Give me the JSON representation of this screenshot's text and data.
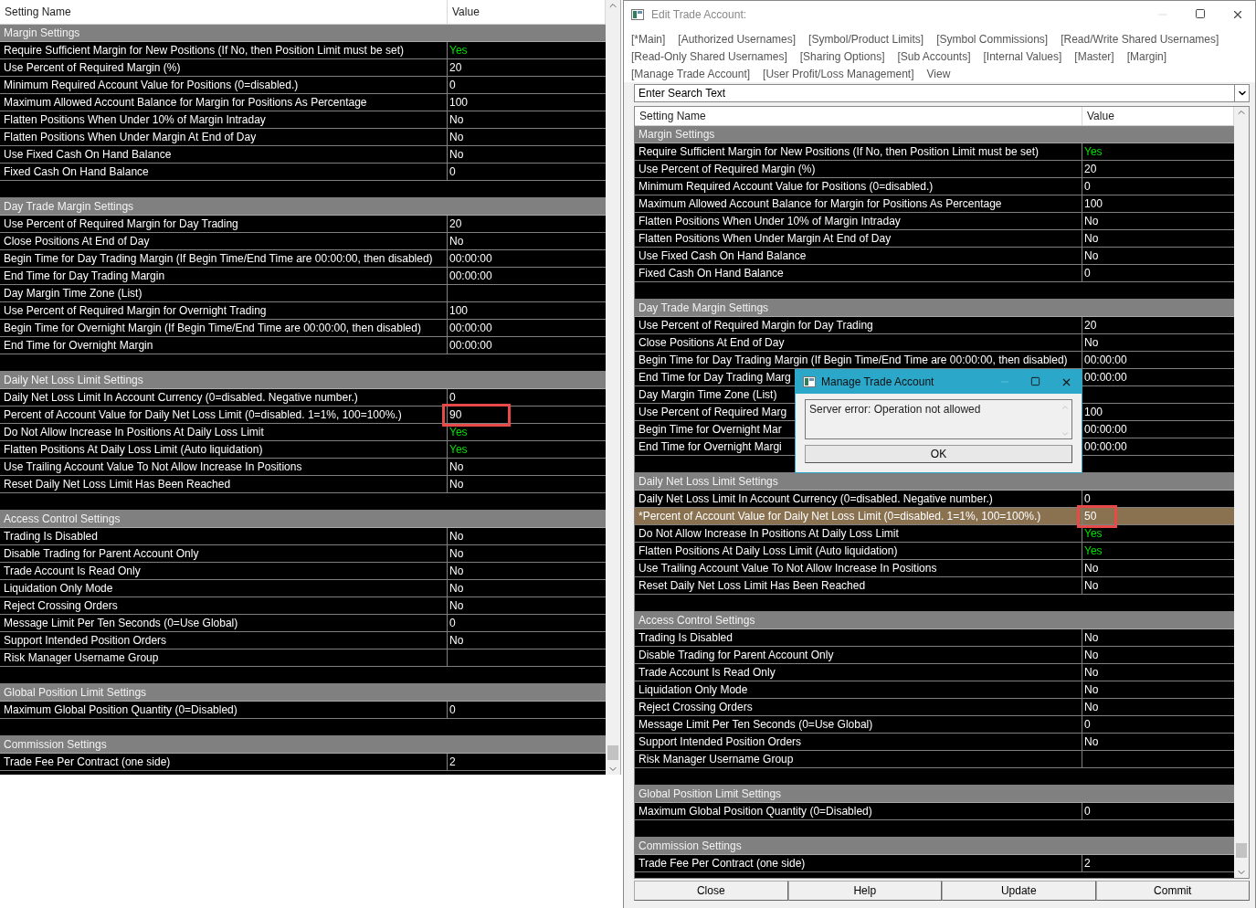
{
  "left_panel": {
    "columns": [
      "Setting Name",
      "Value"
    ],
    "sections": [
      {
        "title": "Margin Settings",
        "rows": [
          {
            "name": "Require Sufficient Margin for New Positions (If No, then Position Limit must be set)",
            "value": "Yes",
            "accent": true,
            "boxed": false
          },
          {
            "name": "Use Percent of Required Margin (%)",
            "value": "20",
            "accent": false,
            "boxed": false
          },
          {
            "name": "Minimum Required Account Value for Positions (0=disabled.)",
            "value": "0",
            "accent": false,
            "boxed": false
          },
          {
            "name": "Maximum Allowed Account Balance for Margin for Positions As Percentage",
            "value": "100",
            "accent": false,
            "boxed": false
          },
          {
            "name": "Flatten Positions When Under 10% of Margin Intraday",
            "value": "No",
            "accent": false,
            "boxed": false
          },
          {
            "name": "Flatten Positions When Under Margin At End of Day",
            "value": "No",
            "accent": false,
            "boxed": false
          },
          {
            "name": "Use Fixed Cash On Hand Balance",
            "value": "No",
            "accent": false,
            "boxed": false
          },
          {
            "name": "Fixed Cash On Hand Balance",
            "value": "0",
            "accent": false,
            "boxed": false
          }
        ]
      },
      {
        "title": "Day Trade Margin Settings",
        "rows": [
          {
            "name": "Use Percent of Required Margin for Day Trading",
            "value": "20",
            "accent": false,
            "boxed": false
          },
          {
            "name": "Close Positions At End of Day",
            "value": "No",
            "accent": false,
            "boxed": false
          },
          {
            "name": "Begin Time for Day Trading Margin (If Begin Time/End Time are 00:00:00, then disabled)",
            "value": "00:00:00",
            "accent": false,
            "boxed": false
          },
          {
            "name": "End Time for Day Trading Margin",
            "value": "00:00:00",
            "accent": false,
            "boxed": false
          },
          {
            "name": "Day Margin Time Zone (List)",
            "boxed": false
          },
          {
            "name": "Use Percent of Required Margin for Overnight Trading",
            "value": "100",
            "accent": false,
            "boxed": false
          },
          {
            "name": "Begin Time for Overnight Margin (If Begin Time/End Time are 00:00:00, then disabled)",
            "value": "00:00:00",
            "accent": false,
            "boxed": false
          },
          {
            "name": "End Time for Overnight Margin",
            "value": "00:00:00",
            "accent": false,
            "boxed": false
          }
        ]
      },
      {
        "title": "Daily Net Loss Limit Settings",
        "rows": [
          {
            "name": "Daily Net Loss Limit In Account Currency (0=disabled. Negative number.)",
            "value": "0",
            "accent": false,
            "boxed": false
          },
          {
            "name": "Percent of Account Value for Daily Net Loss Limit (0=disabled. 1=1%, 100=100%.)",
            "value": "90",
            "accent": false,
            "boxed": true
          },
          {
            "name": "Do Not Allow Increase In Positions At Daily Loss Limit",
            "value": "Yes",
            "accent": true,
            "boxed": false
          },
          {
            "name": "Flatten Positions At Daily Loss Limit (Auto liquidation)",
            "value": "Yes",
            "accent": true,
            "boxed": false
          },
          {
            "name": "Use Trailing Account Value To Not Allow Increase In Positions",
            "value": "No",
            "accent": false,
            "boxed": false
          },
          {
            "name": "Reset Daily Net Loss Limit Has Been Reached",
            "value": "No",
            "accent": false,
            "boxed": false
          }
        ]
      },
      {
        "title": "Access Control Settings",
        "rows": [
          {
            "name": "Trading Is Disabled",
            "value": "No",
            "accent": false,
            "boxed": false
          },
          {
            "name": "Disable Trading for Parent Account Only",
            "value": "No",
            "accent": false,
            "boxed": false
          },
          {
            "name": "Trade Account Is Read Only",
            "value": "No",
            "accent": false,
            "boxed": false
          },
          {
            "name": "Liquidation Only Mode",
            "value": "No",
            "accent": false,
            "boxed": false
          },
          {
            "name": "Reject Crossing Orders",
            "value": "No",
            "accent": false,
            "boxed": false
          },
          {
            "name": "Message Limit Per Ten Seconds (0=Use Global)",
            "value": "0",
            "accent": false,
            "boxed": false
          },
          {
            "name": "Support Intended Position Orders",
            "value": "No",
            "accent": false,
            "boxed": false
          },
          {
            "name": "Risk Manager Username Group",
            "boxed": false
          }
        ]
      },
      {
        "title": "Global Position Limit Settings",
        "rows": [
          {
            "name": "Maximum Global Position Quantity (0=Disabled)",
            "value": "0",
            "accent": false,
            "boxed": false
          }
        ]
      },
      {
        "title": "Commission Settings",
        "rows": [
          {
            "name": "Trade Fee Per Contract (one side)",
            "value": "2",
            "accent": false,
            "boxed": false
          }
        ]
      }
    ]
  },
  "edit_window": {
    "title": "Edit Trade Account:",
    "tab_rows": [
      [
        "[*Main]",
        "[Authorized Usernames]",
        "[Symbol/Product Limits]",
        "[Symbol Commissions]",
        "[Read/Write Shared Usernames]"
      ],
      [
        "[Read-Only Shared Usernames]",
        "[Sharing Options]",
        "[Sub Accounts]",
        "[Internal Values]",
        "[Master]",
        "[Margin]"
      ],
      [
        "[Manage Trade Account]",
        "[User Profit/Loss Management]",
        "View"
      ]
    ],
    "search": {
      "value": "Enter Search Text"
    },
    "table": {
      "columns": [
        "Setting Name",
        "Value"
      ],
      "sections": [
        {
          "title": "Margin Settings",
          "rows": [
            {
              "name": "Require Sufficient Margin for New Positions (If No, then Position Limit must be set)",
              "value": "Yes",
              "accent": true,
              "boxed": false,
              "selected": false
            },
            {
              "name": "Use Percent of Required Margin (%)",
              "value": "20",
              "accent": false,
              "boxed": false,
              "selected": false
            },
            {
              "name": "Minimum Required Account Value for Positions (0=disabled.)",
              "value": "0",
              "accent": false,
              "boxed": false,
              "selected": false
            },
            {
              "name": "Maximum Allowed Account Balance for Margin for Positions As Percentage",
              "value": "100",
              "accent": false,
              "boxed": false,
              "selected": false
            },
            {
              "name": "Flatten Positions When Under 10% of Margin Intraday",
              "value": "No",
              "accent": false,
              "boxed": false,
              "selected": false
            },
            {
              "name": "Flatten Positions When Under Margin At End of Day",
              "value": "No",
              "accent": false,
              "boxed": false,
              "selected": false
            },
            {
              "name": "Use Fixed Cash On Hand Balance",
              "value": "No",
              "accent": false,
              "boxed": false,
              "selected": false
            },
            {
              "name": "Fixed Cash On Hand Balance",
              "value": "0",
              "accent": false,
              "boxed": false,
              "selected": false
            }
          ]
        },
        {
          "title": "Day Trade Margin Settings",
          "rows": [
            {
              "name": "Use Percent of Required Margin for Day Trading",
              "value": "20",
              "accent": false,
              "boxed": false,
              "selected": false
            },
            {
              "name": "Close Positions At End of Day",
              "value": "No",
              "accent": false,
              "boxed": false,
              "selected": false
            },
            {
              "name": "Begin Time for Day Trading Margin (If Begin Time/End Time are 00:00:00, then disabled)",
              "value": "00:00:00",
              "accent": false,
              "boxed": false,
              "selected": false
            },
            {
              "name": "End Time for Day Trading Marg",
              "value": "00:00:00",
              "accent": false,
              "boxed": false,
              "selected": false
            },
            {
              "name": "Day Margin Time Zone (List)",
              "boxed": false,
              "selected": false
            },
            {
              "name": "Use Percent of Required Marg",
              "value": "100",
              "accent": false,
              "boxed": false,
              "selected": false
            },
            {
              "name": "Begin Time for Overnight Mar",
              "value": "00:00:00",
              "accent": false,
              "boxed": false,
              "selected": false
            },
            {
              "name": "End Time for Overnight Margi",
              "value": "00:00:00",
              "accent": false,
              "boxed": false,
              "selected": false
            }
          ]
        },
        {
          "title": "Daily Net Loss Limit Settings",
          "rows": [
            {
              "name": "Daily Net Loss Limit In Account Currency (0=disabled. Negative number.)",
              "value": "0",
              "accent": false,
              "boxed": false,
              "selected": false
            },
            {
              "name": "*Percent of Account Value for Daily Net Loss Limit (0=disabled. 1=1%, 100=100%.)",
              "value": "50",
              "accent": false,
              "boxed": true,
              "selected": true
            },
            {
              "name": "Do Not Allow Increase In Positions At Daily Loss Limit",
              "value": "Yes",
              "accent": true,
              "boxed": false,
              "selected": false
            },
            {
              "name": "Flatten Positions At Daily Loss Limit (Auto liquidation)",
              "value": "Yes",
              "accent": true,
              "boxed": false,
              "selected": false
            },
            {
              "name": "Use Trailing Account Value To Not Allow Increase In Positions",
              "value": "No",
              "accent": false,
              "boxed": false,
              "selected": false
            },
            {
              "name": "Reset Daily Net Loss Limit Has Been Reached",
              "value": "No",
              "accent": false,
              "boxed": false,
              "selected": false
            }
          ]
        },
        {
          "title": "Access Control Settings",
          "rows": [
            {
              "name": "Trading Is Disabled",
              "value": "No",
              "accent": false,
              "boxed": false,
              "selected": false
            },
            {
              "name": "Disable Trading for Parent Account Only",
              "value": "No",
              "accent": false,
              "boxed": false,
              "selected": false
            },
            {
              "name": "Trade Account Is Read Only",
              "value": "No",
              "accent": false,
              "boxed": false,
              "selected": false
            },
            {
              "name": "Liquidation Only Mode",
              "value": "No",
              "accent": false,
              "boxed": false,
              "selected": false
            },
            {
              "name": "Reject Crossing Orders",
              "value": "No",
              "accent": false,
              "boxed": false,
              "selected": false
            },
            {
              "name": "Message Limit Per Ten Seconds (0=Use Global)",
              "value": "0",
              "accent": false,
              "boxed": false,
              "selected": false
            },
            {
              "name": "Support Intended Position Orders",
              "value": "No",
              "accent": false,
              "boxed": false,
              "selected": false
            },
            {
              "name": "Risk Manager Username Group",
              "boxed": false,
              "selected": false
            }
          ]
        },
        {
          "title": "Global Position Limit Settings",
          "rows": [
            {
              "name": "Maximum Global Position Quantity (0=Disabled)",
              "value": "0",
              "accent": false,
              "boxed": false,
              "selected": false
            }
          ]
        },
        {
          "title": "Commission Settings",
          "rows": [
            {
              "name": "Trade Fee Per Contract (one side)",
              "value": "2",
              "accent": false,
              "boxed": false,
              "selected": false
            }
          ]
        }
      ]
    },
    "buttons": [
      "Close",
      "Help",
      "Update",
      "Commit"
    ]
  },
  "dialog": {
    "title": "Manage Trade Account",
    "message": "Server error: Operation not allowed",
    "button": "OK"
  }
}
